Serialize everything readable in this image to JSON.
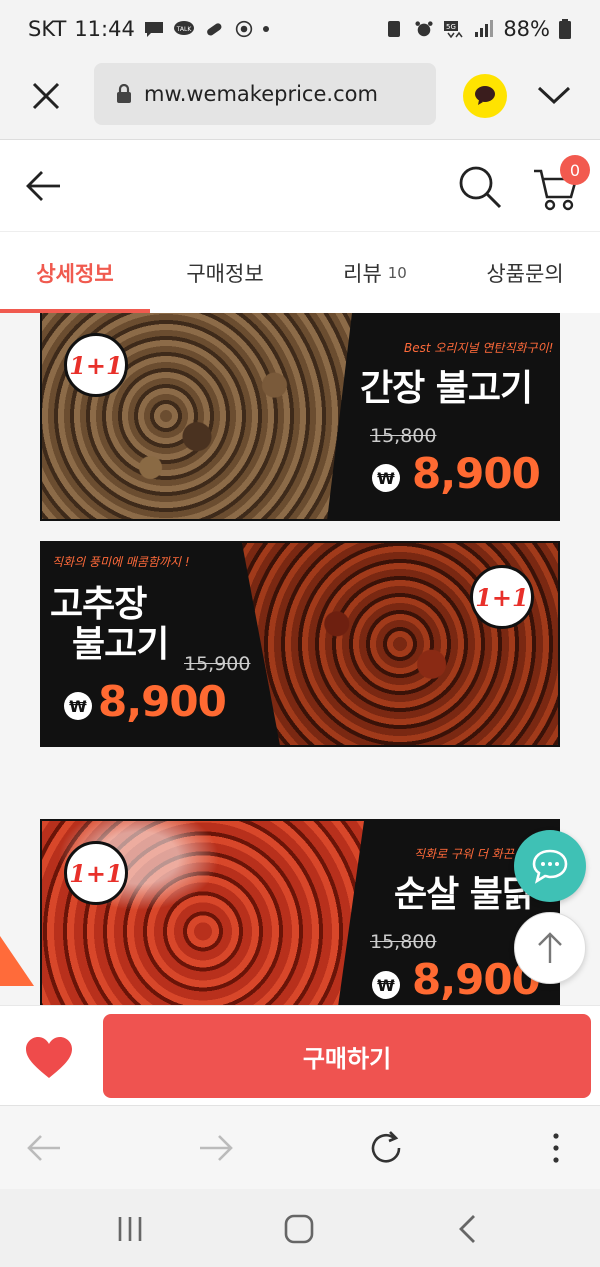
{
  "status_bar": {
    "carrier": "SKT",
    "time": "11:44",
    "battery": "88%",
    "left_icons": [
      "message-icon",
      "talk-icon",
      "pill-icon",
      "starbucks-icon",
      "dot-icon"
    ],
    "right_icons": [
      "recycle-icon",
      "alarm-icon",
      "5g-icon",
      "signal-icon",
      "battery-icon"
    ]
  },
  "browser": {
    "url": "mw.wemakeprice.com"
  },
  "header": {
    "cart_count": "0"
  },
  "tabs": [
    {
      "label": "상세정보",
      "count": ""
    },
    {
      "label": "구매정보",
      "count": ""
    },
    {
      "label": "리뷰",
      "count": "10"
    },
    {
      "label": "상품문의",
      "count": ""
    }
  ],
  "banners": [
    {
      "badge": "1+1",
      "tagline": "Best 오리지널 연탄직화구이!",
      "title_line1": "간장 불고기",
      "title_line2": "",
      "old_price": "15,800",
      "currency": "₩",
      "price": "8,900"
    },
    {
      "badge": "1+1",
      "tagline": "직화의 풍미에 매콤함까지 !",
      "title_line1": "고추장",
      "title_line2": "불고기",
      "old_price": "15,900",
      "currency": "₩",
      "price": "8,900"
    },
    {
      "badge": "1+1",
      "tagline": "직화로 구워 더 화끈",
      "title_line1": "순살 불닭",
      "title_line2": "",
      "old_price": "15,800",
      "currency": "₩",
      "price": "8,900"
    }
  ],
  "buy_bar": {
    "buy_label": "구매하기"
  },
  "colors": {
    "accent": "#ef5350",
    "tab_active": "#f05a4f",
    "price": "#ff6a32",
    "chat_fab": "#3fc1b5",
    "kakao": "#ffe300"
  }
}
